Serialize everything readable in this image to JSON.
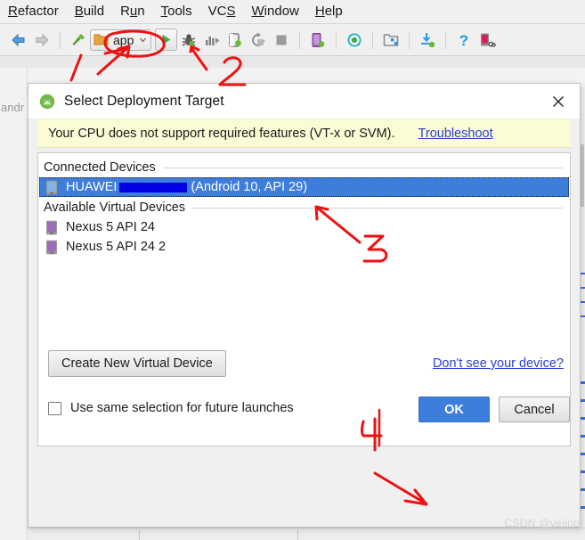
{
  "ide": {
    "menus": [
      {
        "label": "Refactor",
        "mnemonic": "R"
      },
      {
        "label": "Build",
        "mnemonic": "B"
      },
      {
        "label": "Run",
        "mnemonic": "n"
      },
      {
        "label": "Tools",
        "mnemonic": "T"
      },
      {
        "label": "VCS",
        "mnemonic": "S"
      },
      {
        "label": "Window",
        "mnemonic": "W"
      },
      {
        "label": "Help",
        "mnemonic": "H"
      }
    ],
    "toolbar": {
      "back_icon": "arrow-left-icon",
      "forward_icon": "arrow-right-icon",
      "build_icon": "hammer-icon",
      "run_config_label": "app",
      "run_config_icon": "module-folder-icon",
      "run_config_dropdown_icon": "chevron-down-icon",
      "run_icon": "run-play-icon",
      "debug_icon": "debug-bug-icon",
      "profile_icon": "profiler-icon",
      "attach_debugger_icon": "attach-debugger-icon",
      "rerun_icon": "rerun-icon",
      "stop_icon": "stop-square-icon",
      "avd_manager_icon": "avd-manager-icon",
      "sdk_sync_icon": "sync-gradle-icon",
      "project_structure_icon": "project-structure-icon",
      "sdk_manager_icon": "sdk-manager-icon",
      "help_icon": "help-question-icon",
      "device_file_explorer_icon": "device-file-explorer-icon"
    },
    "breadcrumb": "andr"
  },
  "dialog": {
    "icon": "android-studio-icon",
    "title": "Select Deployment Target",
    "close_icon": "close-icon",
    "warning": {
      "text": "Your CPU does not support required features (VT-x or SVM).",
      "link": "Troubleshoot"
    },
    "groups": [
      {
        "heading": "Connected Devices",
        "devices": [
          {
            "icon": "physical-device-icon",
            "prefix": "HUAWEI",
            "redacted": true,
            "suffix": "(Android 10, API 29)",
            "selected": true
          }
        ]
      },
      {
        "heading": "Available Virtual Devices",
        "devices": [
          {
            "icon": "virtual-device-icon",
            "prefix": "Nexus 5 API 24",
            "redacted": false,
            "suffix": "",
            "selected": false
          },
          {
            "icon": "virtual-device-icon",
            "prefix": "Nexus 5 API 24 2",
            "redacted": false,
            "suffix": "",
            "selected": false
          }
        ]
      }
    ],
    "footer": {
      "create_button": "Create New Virtual Device",
      "see_device_link": "Don't see your device?",
      "checkbox_label": "Use same selection for future launches",
      "checkbox_checked": false,
      "ok_button": "OK",
      "cancel_button": "Cancel"
    }
  },
  "annotations": {
    "color": "#ee1111",
    "markers": [
      {
        "label": "1"
      },
      {
        "label": "2"
      },
      {
        "label": "3"
      },
      {
        "label": "4"
      }
    ]
  },
  "watermark": "CSDN @velinb",
  "colors": {
    "accent_blue": "#3d7ddb",
    "link_blue": "#2a3fd4",
    "warning_yellow": "#fbfbd6",
    "annotation_red": "#ee1111",
    "redaction_blue": "#0000e2"
  }
}
